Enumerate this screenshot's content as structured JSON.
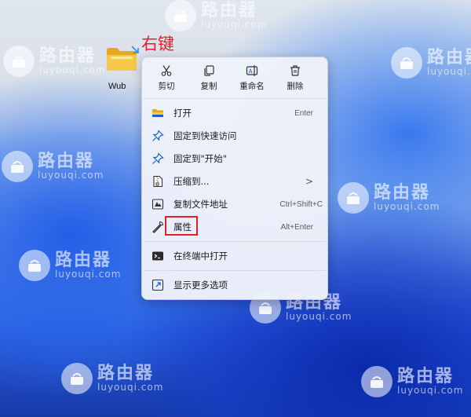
{
  "watermark": {
    "brand": "路由器",
    "site": "luyouqi.com"
  },
  "desktop": {
    "folder_name": "Wub",
    "annotation": "右键"
  },
  "menu": {
    "toolbar": [
      {
        "label": "剪切",
        "icon": "cut-icon"
      },
      {
        "label": "复制",
        "icon": "copy-icon"
      },
      {
        "label": "重命名",
        "icon": "rename-icon"
      },
      {
        "label": "删除",
        "icon": "delete-icon"
      }
    ],
    "items": [
      {
        "label": "打开",
        "shortcut": "Enter",
        "icon": "folder-open-icon"
      },
      {
        "label": "固定到快速访问",
        "shortcut": "",
        "icon": "pin-icon"
      },
      {
        "label": "固定到\"开始\"",
        "shortcut": "",
        "icon": "pin-icon"
      },
      {
        "label": "压缩到...",
        "shortcut": "",
        "icon": "zip-icon",
        "submenu": ">"
      },
      {
        "label": "复制文件地址",
        "shortcut": "Ctrl+Shift+C",
        "icon": "copy-path-icon"
      },
      {
        "label": "属性",
        "shortcut": "Alt+Enter",
        "icon": "wrench-icon"
      },
      {
        "label": "在终端中打开",
        "shortcut": "",
        "icon": "terminal-icon"
      },
      {
        "label": "显示更多选项",
        "shortcut": "",
        "icon": "more-options-icon"
      }
    ]
  },
  "colors": {
    "annotation": "#e0202a",
    "menu_bg": "#eef2fa",
    "accent": "#1a5fd0"
  }
}
